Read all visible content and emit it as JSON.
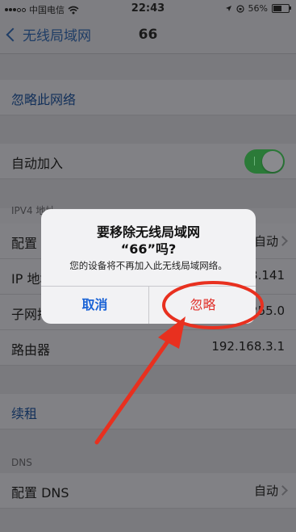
{
  "status_bar": {
    "carrier": "中国电信",
    "time": "22:43",
    "battery": "56%",
    "battery_level": 0.56
  },
  "nav": {
    "back_label": "无线局域网",
    "title": "66"
  },
  "rows": {
    "forget": "忽略此网络",
    "auto_join": "自动加入",
    "auto_join_on": true,
    "ipv4_header": "IPV4 地址",
    "configure_ip": {
      "label": "配置 IP",
      "value": "自动"
    },
    "ip_address": {
      "label": "IP 地址",
      "value": "192.168.3.141"
    },
    "subnet": {
      "label": "子网掩码",
      "value": "255.255.255.0"
    },
    "router": {
      "label": "路由器",
      "value": "192.168.3.1"
    },
    "renew": "续租",
    "dns_header": "DNS",
    "configure_dns": {
      "label": "配置 DNS",
      "value": "自动"
    }
  },
  "alert": {
    "title_line1": "要移除无线局域网",
    "title_line2": "“66”吗?",
    "message": "您的设备将不再加入此无线局域网络。",
    "cancel": "取消",
    "ignore": "忽略"
  },
  "colors": {
    "annotation": "#e8301f",
    "cancel": "#1a63d6",
    "ignore": "#e0302a",
    "toggle": "#2b7a38"
  }
}
